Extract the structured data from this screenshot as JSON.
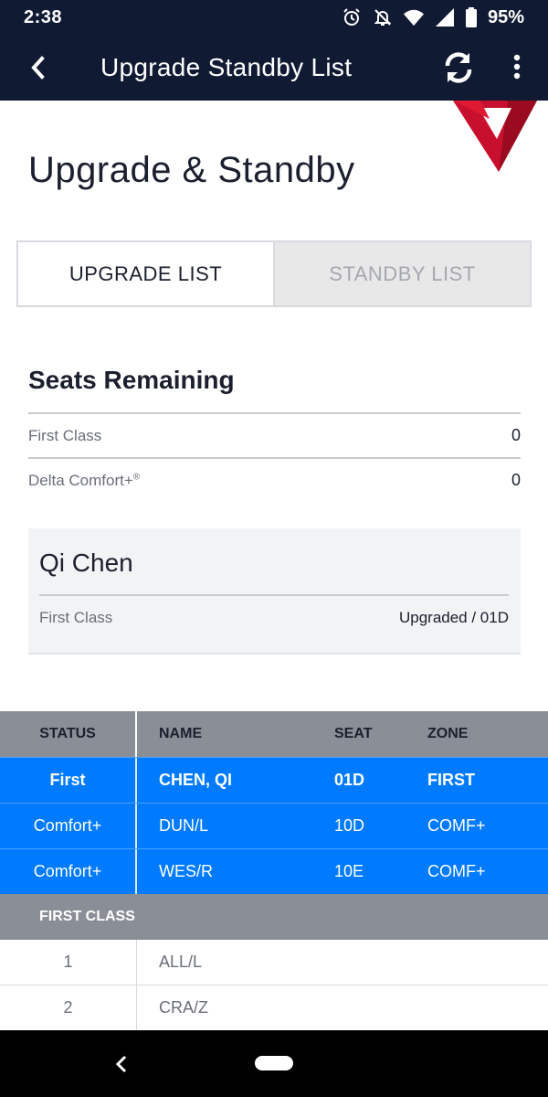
{
  "status_bar": {
    "time": "2:38",
    "battery": "95%",
    "icons": [
      "alarm-icon",
      "bell-off-icon",
      "wifi-icon",
      "signal-icon",
      "battery-icon"
    ]
  },
  "app_bar": {
    "title": "Upgrade Standby List",
    "icons": [
      "back-icon",
      "refresh-icon",
      "more-vert-icon"
    ]
  },
  "brand": {
    "logo_colors": [
      "#c8102e",
      "#e01933",
      "#9a0b20"
    ]
  },
  "page_title": "Upgrade & Standby",
  "tabs": [
    {
      "label": "UPGRADE LIST",
      "active": true
    },
    {
      "label": "STANDBY LIST",
      "active": false
    }
  ],
  "seats_remaining": {
    "title": "Seats Remaining",
    "rows": [
      {
        "label": "First Class",
        "sup": "",
        "value": "0"
      },
      {
        "label": "Delta Comfort+",
        "sup": "®",
        "value": "0"
      }
    ]
  },
  "passenger": {
    "name": "Qi Chen",
    "cabin": "First Class",
    "status": "Upgraded / 01D"
  },
  "upgrade_table": {
    "headers": {
      "status": "STATUS",
      "name": "NAME",
      "seat": "SEAT",
      "zone": "ZONE"
    },
    "rows": [
      {
        "status": "First",
        "name": "CHEN, QI",
        "seat": "01D",
        "zone": "FIRST"
      },
      {
        "status": "Comfort+",
        "name": "DUN/L",
        "seat": "10D",
        "zone": "COMF+"
      },
      {
        "status": "Comfort+",
        "name": "WES/R",
        "seat": "10E",
        "zone": "COMF+"
      }
    ],
    "section_label": "FIRST CLASS",
    "list": [
      {
        "position": "1",
        "name": "ALL/L"
      },
      {
        "position": "2",
        "name": "CRA/Z"
      }
    ]
  },
  "colors": {
    "header_bg": "#111a33",
    "accent_blue": "#007bff",
    "table_header_gray": "#8a8e96"
  }
}
